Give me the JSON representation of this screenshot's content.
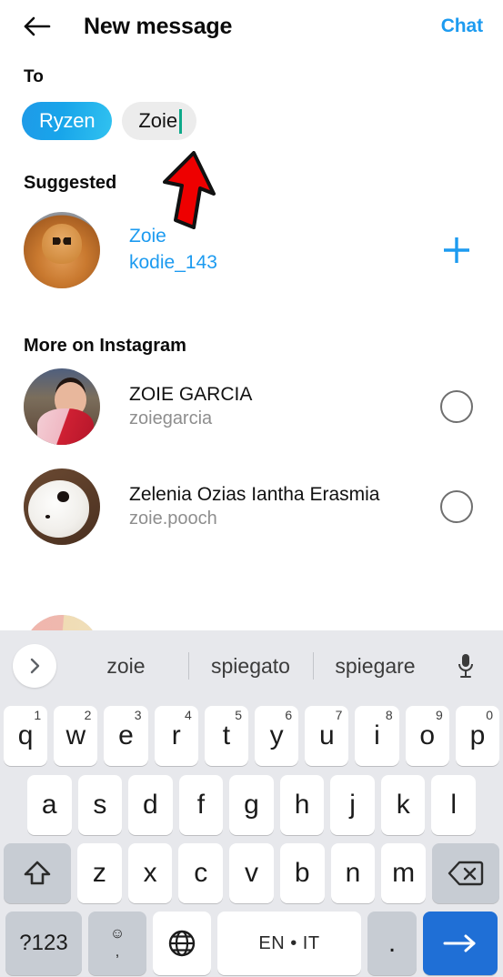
{
  "header": {
    "back_icon": "back-arrow-icon",
    "title": "New message",
    "action_label": "Chat",
    "accent_color": "#1d9bf0"
  },
  "compose": {
    "to_label": "To",
    "chips": [
      {
        "label": "Ryzen",
        "state": "selected"
      },
      {
        "label": "Zoie",
        "state": "typing"
      }
    ]
  },
  "annotation": {
    "type": "red-arrow",
    "color": "#ee0000",
    "points_to": "Zoie"
  },
  "suggested": {
    "title": "Suggested",
    "items": [
      {
        "name": "Zoie",
        "handle": "kodie_143",
        "avatar": "golden-cocker-spaniel-dog",
        "action": "add",
        "action_icon": "plus-icon"
      }
    ]
  },
  "more_on_instagram": {
    "title": "More on Instagram",
    "items": [
      {
        "name": "ZOIE GARCIA",
        "handle": "zoiegarcia",
        "avatar": "woman-in-red-and-pink-outdoors",
        "action_icon": "radio-circle-icon",
        "selected": false
      },
      {
        "name": "Zelenia Ozias Iantha Erasmia",
        "handle": "zoie.pooch",
        "avatar": "white-fluffy-dog",
        "action_icon": "radio-circle-icon",
        "selected": false
      },
      {
        "name": "",
        "handle": "",
        "avatar": "peach-cream-partial",
        "action_icon": "radio-circle-icon",
        "selected": false
      }
    ]
  },
  "keyboard": {
    "expand_icon": "chevron-right-icon",
    "mic_icon": "microphone-icon",
    "suggestions": [
      "zoie",
      "spiegato",
      "spiegare"
    ],
    "row1": [
      {
        "key": "q",
        "num": "1"
      },
      {
        "key": "w",
        "num": "2"
      },
      {
        "key": "e",
        "num": "3"
      },
      {
        "key": "r",
        "num": "4"
      },
      {
        "key": "t",
        "num": "5"
      },
      {
        "key": "y",
        "num": "6"
      },
      {
        "key": "u",
        "num": "7"
      },
      {
        "key": "i",
        "num": "8"
      },
      {
        "key": "o",
        "num": "9"
      },
      {
        "key": "p",
        "num": "0"
      }
    ],
    "row2": [
      "a",
      "s",
      "d",
      "f",
      "g",
      "h",
      "j",
      "k",
      "l"
    ],
    "row3": [
      "z",
      "x",
      "c",
      "v",
      "b",
      "n",
      "m"
    ],
    "shift_icon": "shift-arrow-icon",
    "backspace_icon": "backspace-icon",
    "sym_label": "?123",
    "emoji_icon": "emoji-smiley-icon",
    "comma_label": ",",
    "globe_icon": "globe-language-icon",
    "space_label": "EN • IT",
    "period_label": ".",
    "enter_icon": "arrow-right-enter-icon",
    "enter_color": "#1f6fd6"
  }
}
